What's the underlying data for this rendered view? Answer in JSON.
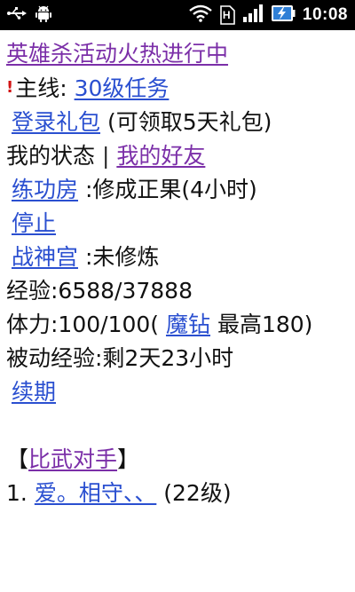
{
  "status_bar": {
    "time": "10:08",
    "icons": [
      "usb-icon",
      "android-debug-icon",
      "wifi-icon",
      "sim-icon",
      "signal-icon",
      "battery-charging-icon"
    ],
    "sim_label": "H"
  },
  "page": {
    "title_link": "英雄杀活动火热进行中",
    "mainline": {
      "marker": "!",
      "label": "主线: ",
      "link": "30级任务"
    },
    "login_gift": {
      "link": "登录礼包",
      "note": " (可领取5天礼包)"
    },
    "status_row": {
      "my_status": "我的状态",
      "separator": " | ",
      "friends_link": "我的好友"
    },
    "practice": {
      "link": "练功房",
      "text": " :修成正果(4小时)"
    },
    "stop_link": "停止",
    "war_palace": {
      "link": "战神宫",
      "text": " :未修炼"
    },
    "exp": "经验:6588/37888",
    "stamina": {
      "prefix": "体力:100/100( ",
      "link": "魔钻",
      "suffix": " 最高180)"
    },
    "passive_exp": "被动经验:剩2天23小时",
    "renew_link": "续期",
    "rivals": {
      "open": "【",
      "link": "比武对手",
      "close": "】"
    },
    "rival_list": [
      {
        "index": "1. ",
        "name": "爱。相守、、",
        "level": " (22级)"
      }
    ]
  }
}
